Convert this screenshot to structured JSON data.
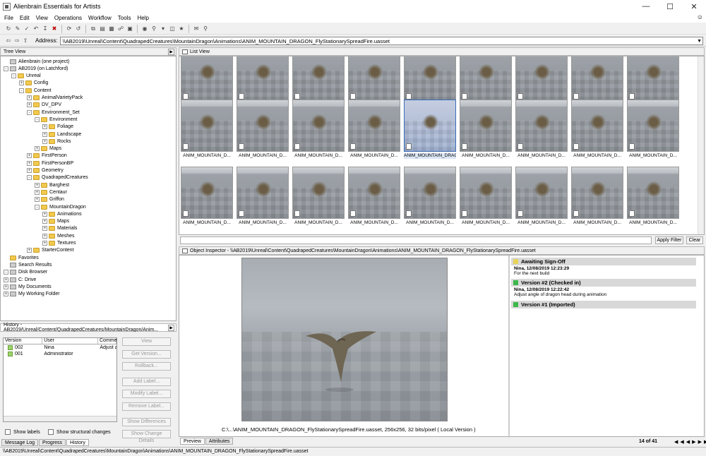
{
  "window": {
    "title": "Alienbrain Essentials for Artists"
  },
  "menu": [
    "File",
    "Edit",
    "View",
    "Operations",
    "Workflow",
    "Tools",
    "Help"
  ],
  "address": {
    "label": "Address:",
    "value": "\\\\AB2019\\Unreal\\Content\\QuadrapedCreatures\\MountainDragon\\Animations\\ANIM_MOUNTAIN_DRAGON_FlyStationarySpreadFire.uasset"
  },
  "tree": {
    "title": "Tree View",
    "items": [
      {
        "label": "Alienbrain (one project)",
        "level": 0,
        "exp": "",
        "icon": "db"
      },
      {
        "label": "AB2019 (on Latchford)",
        "level": 0,
        "exp": "-",
        "icon": "db"
      },
      {
        "label": "Unreal",
        "level": 1,
        "exp": "-",
        "icon": "folder"
      },
      {
        "label": "Config",
        "level": 2,
        "exp": "+",
        "icon": "folder"
      },
      {
        "label": "Content",
        "level": 2,
        "exp": "-",
        "icon": "folder"
      },
      {
        "label": "AnimalVarietyPack",
        "level": 3,
        "exp": "+",
        "icon": "folder"
      },
      {
        "label": "DV_DPV",
        "level": 3,
        "exp": "+",
        "icon": "folder"
      },
      {
        "label": "Environment_Set",
        "level": 3,
        "exp": "-",
        "icon": "folder"
      },
      {
        "label": "Environment",
        "level": 4,
        "exp": "-",
        "icon": "folder"
      },
      {
        "label": "Foliage",
        "level": 5,
        "exp": "+",
        "icon": "folder"
      },
      {
        "label": "Landscape",
        "level": 5,
        "exp": "+",
        "icon": "folder"
      },
      {
        "label": "Rocks",
        "level": 5,
        "exp": "+",
        "icon": "folder"
      },
      {
        "label": "Maps",
        "level": 4,
        "exp": "+",
        "icon": "folder"
      },
      {
        "label": "FirstPerson",
        "level": 3,
        "exp": "+",
        "icon": "folder"
      },
      {
        "label": "FirstPersonBP",
        "level": 3,
        "exp": "+",
        "icon": "folder"
      },
      {
        "label": "Geometry",
        "level": 3,
        "exp": "+",
        "icon": "folder"
      },
      {
        "label": "QuadrapedCreatures",
        "level": 3,
        "exp": "-",
        "icon": "folder"
      },
      {
        "label": "Barghest",
        "level": 4,
        "exp": "+",
        "icon": "folder"
      },
      {
        "label": "Centaur",
        "level": 4,
        "exp": "+",
        "icon": "folder"
      },
      {
        "label": "Griffon",
        "level": 4,
        "exp": "+",
        "icon": "folder"
      },
      {
        "label": "MountainDragon",
        "level": 4,
        "exp": "-",
        "icon": "folder"
      },
      {
        "label": "Animations",
        "level": 5,
        "exp": "+",
        "icon": "folder"
      },
      {
        "label": "Maps",
        "level": 5,
        "exp": "+",
        "icon": "folder"
      },
      {
        "label": "Materials",
        "level": 5,
        "exp": "+",
        "icon": "folder"
      },
      {
        "label": "Meshes",
        "level": 5,
        "exp": "+",
        "icon": "folder"
      },
      {
        "label": "Textures",
        "level": 5,
        "exp": "+",
        "icon": "folder"
      },
      {
        "label": "StarterContent",
        "level": 3,
        "exp": "+",
        "icon": "folder"
      },
      {
        "label": "Favorites",
        "level": 0,
        "exp": "",
        "icon": "folder"
      },
      {
        "label": "Search Results",
        "level": 0,
        "exp": "",
        "icon": "db"
      },
      {
        "label": "Disk Browser",
        "level": 0,
        "exp": "-",
        "icon": "db"
      },
      {
        "label": "C: Drive",
        "level": 0,
        "exp": "+",
        "icon": "db"
      },
      {
        "label": "My Documents",
        "level": 0,
        "exp": "+",
        "icon": "db"
      },
      {
        "label": "My Working Folder",
        "level": 0,
        "exp": "+",
        "icon": "db"
      }
    ]
  },
  "history": {
    "title": "History - AB2019/Unreal/Content/QuadrapedCreatures/MountainDragon/Anim...",
    "columns": [
      "Version",
      "User",
      "Comme"
    ],
    "rows": [
      {
        "version": "002",
        "user": "Nina",
        "comment": "Adjust a"
      },
      {
        "version": "001",
        "user": "Administrator",
        "comment": ""
      }
    ],
    "buttons": [
      "View",
      "Get Version...",
      "Rollback...",
      "Add Label...",
      "Modify Label...",
      "Remove Label...",
      "Show Differences",
      "Show Change Details"
    ],
    "show_labels": "Show labels",
    "show_structural": "Show structural changes"
  },
  "bottom_tabs": [
    "Message Log",
    "Progress",
    "History"
  ],
  "list": {
    "title": "List View",
    "tile_label": "ANIM_MOUNTAIN_D...",
    "selected_label": "ANIM_MOUNTAIN_DRAGON_FlyStationarySpreadFire.uasset",
    "apply_filter": "Apply Filter",
    "clear": "Clear"
  },
  "inspector": {
    "title": "Object Inspector - \\\\AB2019\\Unreal\\Content\\QuadrapedCreatures\\MountainDragon\\Animations\\ANIM_MOUNTAIN_DRAGON_FlyStationarySpreadFire.uasset",
    "caption": "C:\\...\\ANIM_MOUNTAIN_DRAGON_FlyStationarySpreadFire.uasset, 256x256, 32 bits/pixel  ( Local Version )",
    "tabs": [
      "Preview",
      "Attributes"
    ],
    "versions": [
      {
        "header": "Awaiting Sign-Off",
        "color": "#e6d35a",
        "meta": "Nina, 12/08/2019 12:23:29",
        "desc": "For the next build"
      },
      {
        "header": "Version #2 (Checked in)",
        "color": "#3cb84a",
        "meta": "Nina, 12/08/2019 12:22:42",
        "desc": "Adjust angle of dragon head during animation"
      },
      {
        "header": "Version #1 (Imported)",
        "color": "#3cb84a",
        "meta": "",
        "desc": ""
      }
    ],
    "pager": "14 of 41"
  },
  "status": "\\\\AB2019\\Unreal\\Content\\QuadrapedCreatures\\MountainDragon\\Animations\\ANIM_MOUNTAIN_DRAGON_FlyStationarySpreadFire.uasset"
}
